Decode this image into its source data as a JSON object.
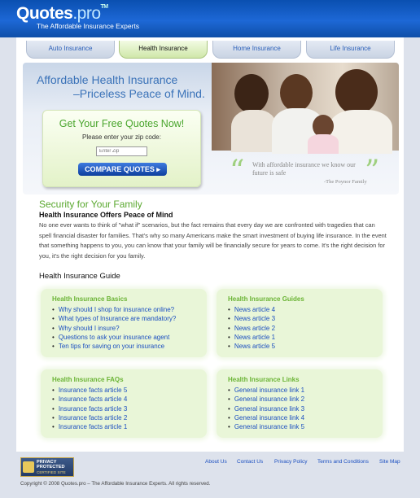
{
  "header": {
    "logo_main": "Quotes",
    "logo_pro": ".pro",
    "logo_tm": "TM",
    "tagline": "The Affordable Insurance Experts"
  },
  "nav": {
    "tabs": [
      {
        "label": "Auto Insurance"
      },
      {
        "label": "Health Insurance",
        "active": true
      },
      {
        "label": "Home Insurance"
      },
      {
        "label": "Life Insurance"
      }
    ]
  },
  "hero": {
    "line1": "Affordable Health Insurance",
    "line2": "–Priceless Peace of Mind."
  },
  "quote_form": {
    "title": "Get Your Free Quotes Now!",
    "label": "Please enter your zip code:",
    "zip_placeholder": "Enter Zip",
    "button": "COMPARE QUOTES ▸"
  },
  "testimonial": {
    "text": "With affordable insurance we know our future is safe",
    "author": "-The Poynor Family"
  },
  "content": {
    "security_heading": "Security for Your Family",
    "offers_heading": "Health Insurance Offers Peace of Mind",
    "body": "No one ever wants to think of \"what if\" scenarios, but the fact remains that every day we are confronted with tragedies that can spell financial disaster for families. That's why so many Americans make the smart investment of buying life insurance. In the event that something happens to you, you can know that your family will be financially secure for years to come. It's the right decision for you, it's the right decision for you family.",
    "guide_heading": "Health Insurance Guide"
  },
  "guide": {
    "basics": {
      "title": "Health Insurance Basics",
      "items": [
        "Why should I shop for insurance online?",
        "What types of Insurance are mandatory?",
        "Why should I insure?",
        "Questions to ask your insurance agent",
        "Ten tips for saving on your insurance"
      ]
    },
    "guides": {
      "title": "Health Insurance Guides",
      "items": [
        "News article 4",
        "News article 3",
        "News article 2",
        "News article 1",
        "News article 5"
      ]
    },
    "faqs": {
      "title": "Health Insurance FAQs",
      "items": [
        "Insurance facts article 5",
        "Insurance facts article 4",
        "Insurance facts article 3",
        "Insurance facts article 2",
        "Insurance facts article 1"
      ]
    },
    "links": {
      "title": "Health Insurance Links",
      "items": [
        "General insurance link 1",
        "General insurance link 2",
        "General insurance link 3",
        "General insurance link 4",
        "General insurance link 5"
      ]
    }
  },
  "footer": {
    "badge_line1": "PRIVACY",
    "badge_line2": "PROTECTED",
    "badge_line3": "CERTIFIED SITE",
    "links": [
      "About Us",
      "Contact Us",
      "Privacy Policy",
      "Terms and Conditions",
      "Site Map"
    ],
    "copyright": "Copyright © 2008 Quotes.pro – The Affordable Insurance Experts. All rights reserved."
  }
}
